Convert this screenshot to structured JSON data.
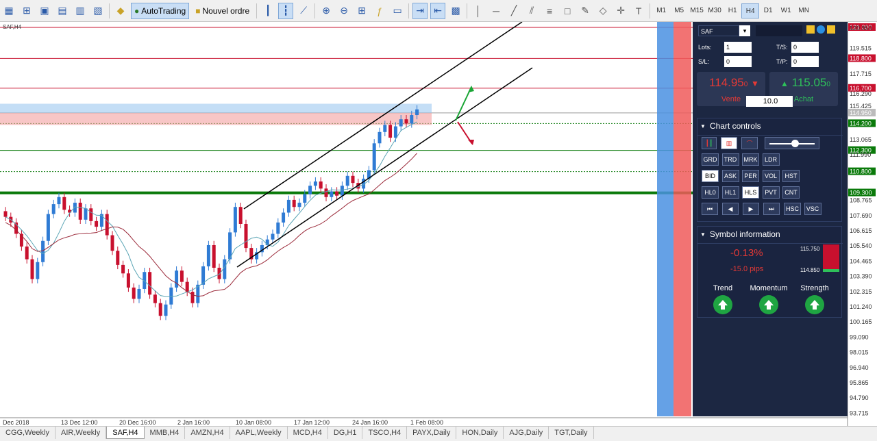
{
  "toolbar": {
    "autotrading_label": "AutoTrading",
    "new_order_label": "Nouvel ordre",
    "timeframes": [
      "M1",
      "M5",
      "M15",
      "M30",
      "H1",
      "H4",
      "D1",
      "W1",
      "MN"
    ],
    "active_timeframe": "H4"
  },
  "chart": {
    "symbol_label": "SAF,H4",
    "price_axis": [
      "121.000",
      "120.950",
      "119.515",
      "118.800",
      "117.715",
      "116.700",
      "116.290",
      "115.425",
      "114.950",
      "114.200",
      "113.065",
      "112.300",
      "111.990",
      "110.800",
      "109.300",
      "108.765",
      "107.690",
      "106.615",
      "105.540",
      "104.465",
      "103.390",
      "102.315",
      "101.240",
      "100.165",
      "99.090",
      "98.015",
      "96.940",
      "95.865",
      "94.790",
      "93.715"
    ],
    "time_axis": [
      "Dec 2018",
      "13 Dec 12:00",
      "20 Dec 16:00",
      "2 Jan 16:00",
      "10 Jan 08:00",
      "17 Jan 12:00",
      "24 Jan 16:00",
      "1 Feb 08:00"
    ],
    "highlight_prices": {
      "red": [
        "121.000",
        "118.800",
        "116.700"
      ],
      "green": [
        "114.200",
        "112.300",
        "110.800",
        "109.300"
      ],
      "grey": [
        "114.950"
      ]
    },
    "colors": {
      "bull_candle": "#2f7bd4",
      "bear_candle": "#c8102e",
      "green_level": "#0a7a0a",
      "red_level": "#c8102e",
      "ma_fast": "#5aa5b5",
      "ma_slow": "#9b2a3a"
    }
  },
  "panel": {
    "symbol": "SAF",
    "lots_label": "Lots:",
    "lots_value": "1",
    "sl_label": "S/L:",
    "sl_value": "0",
    "ts_label": "T/S:",
    "ts_value": "0",
    "tp_label": "T/P:",
    "tp_value": "0",
    "sell_price_main": "114.95",
    "sell_price_small": "0",
    "buy_price_main": "115.05",
    "buy_price_small": "0",
    "sell_label": "Vente",
    "buy_label": "Achat",
    "spread_value": "10.0",
    "chart_controls_title": "Chart controls",
    "control_rows": [
      [
        "GRD",
        "TRD",
        "MRK",
        "LDR"
      ],
      [
        "BID",
        "ASK",
        "PER",
        "VOL",
        "HST"
      ],
      [
        "HL0",
        "HL1",
        "HLS",
        "PVT",
        "CNT"
      ],
      [
        "HSC",
        "VSC"
      ]
    ],
    "active_controls": [
      "BID",
      "HLS"
    ],
    "symbol_info_title": "Symbol information",
    "change_percent": "-0.13%",
    "change_pips": "-15.0 pips",
    "range_high": "115.750",
    "range_low": "114.850",
    "indicators": [
      "Trend",
      "Momentum",
      "Strength"
    ]
  },
  "tabs": {
    "items": [
      "CGG,Weekly",
      "AIR,Weekly",
      "SAF,H4",
      "MMB,H4",
      "AMZN,H4",
      "AAPL,Weekly",
      "MCD,H4",
      "DG,H1",
      "TSCO,H4",
      "PAYX,Daily",
      "HON,Daily",
      "AJG,Daily",
      "TGT,Daily"
    ],
    "active": "SAF,H4"
  }
}
